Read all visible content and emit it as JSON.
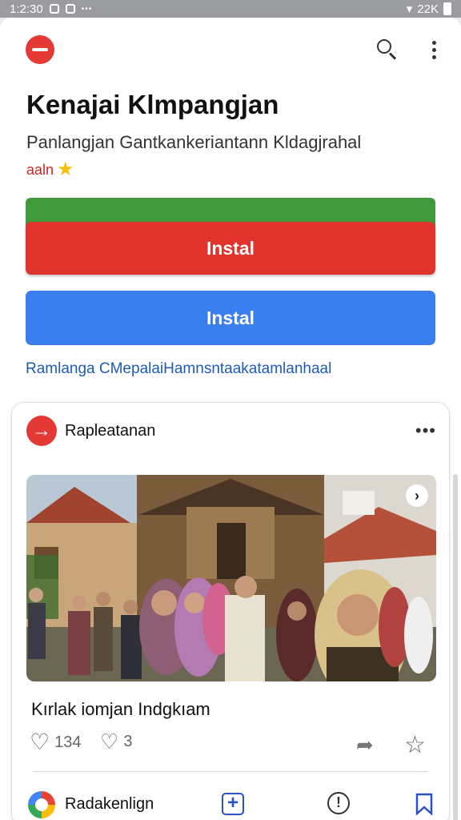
{
  "status_bar": {
    "time": "1:2:30",
    "battery": "22K"
  },
  "app": {
    "title": "Kenajai Klmpangjan",
    "subtitle": "Panlangjan Gantkankeriantann Kldagjrahal",
    "rating_label": "aaln",
    "install_red_label": "Instal",
    "install_blue_label": "Instal",
    "link_text": "Ramlanga CMepalaiHamnsntaakatamlanhaal"
  },
  "post": {
    "author": "Rapleatanan",
    "caption": "Kırlak iomjan Indgkıam",
    "likes": "134",
    "comments": "3",
    "footer_name": "Radakenlign"
  },
  "icons": {
    "top": [
      "app-logo-icon",
      "search-icon",
      "more-vert-icon"
    ],
    "post": [
      "heart-icon",
      "comment-icon",
      "share-icon",
      "star-icon",
      "add-icon",
      "report-icon",
      "bookmark-icon"
    ]
  },
  "colors": {
    "red": "#e0332b",
    "green": "#3f9a3c",
    "blue": "#3a7ff0",
    "link": "#1e5bb8"
  }
}
